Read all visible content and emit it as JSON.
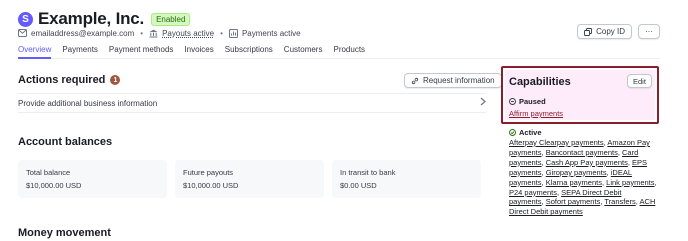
{
  "account": {
    "logo_letter": "S",
    "name": "Example, Inc.",
    "status": "Enabled",
    "email": "emailaddress@example.com",
    "payouts": "Payouts active",
    "payments": "Payments active"
  },
  "header_buttons": {
    "copy_id": "Copy ID",
    "more": "···"
  },
  "tabs": [
    {
      "label": "Overview",
      "active": true
    },
    {
      "label": "Payments",
      "active": false
    },
    {
      "label": "Payment methods",
      "active": false
    },
    {
      "label": "Invoices",
      "active": false
    },
    {
      "label": "Subscriptions",
      "active": false
    },
    {
      "label": "Customers",
      "active": false
    },
    {
      "label": "Products",
      "active": false
    }
  ],
  "actions": {
    "title": "Actions required",
    "count": "1",
    "request_button": "Request information",
    "item": "Provide additional business information"
  },
  "balances": {
    "title": "Account balances",
    "cards": [
      {
        "label": "Total balance",
        "value": "$10,000.00 USD"
      },
      {
        "label": "Future payouts",
        "value": "$10,000.00 USD"
      },
      {
        "label": "In transit to bank",
        "value": "$0.00 USD"
      }
    ]
  },
  "money": {
    "title": "Money movement"
  },
  "capabilities": {
    "title": "Capabilities",
    "edit": "Edit",
    "paused_label": "Paused",
    "paused_items": [
      "Affirm payments"
    ],
    "active_label": "Active",
    "active_items": [
      "Afterpay Clearpay payments",
      "Amazon Pay payments",
      "Bancontact payments",
      "Card payments",
      "Cash App Pay payments",
      "EPS payments",
      "Giropay payments",
      "iDEAL payments",
      "Klarna payments",
      "Link payments",
      "P24 payments",
      "SEPA Direct Debit payments",
      "Sofort payments",
      "Transfers",
      "ACH Direct Debit payments"
    ]
  },
  "colors": {
    "brand": "#635bff",
    "highlight_border": "#8b1e2c",
    "enabled_badge": "#d7f7c2"
  }
}
